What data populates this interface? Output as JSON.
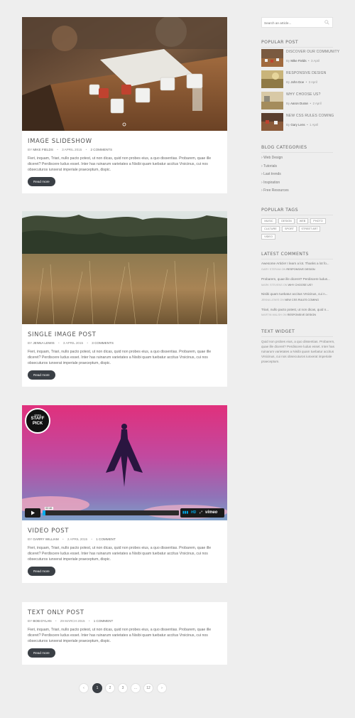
{
  "posts": [
    {
      "title": "IMAGE SLIDESHOW",
      "meta_by": "BY",
      "author": "MIKE FIELDS",
      "date": "3 APRIL 2015",
      "comments": "2 COMMENTS",
      "excerpt": "Fieri, inquam, Triari, nullo pacto potest, ut non dicas, quid non probes eius, a quo dissentias. Probarem, quae ille diceret? Perdiscere ludus esset. Inter has ruinarum varietates a Nisibi quam tuebatur accitus Vrsicinus, cui nos obsecuturos iunxerat imperiale praeceptum, dispic.",
      "read_more": "Read more"
    },
    {
      "title": "SINGLE IMAGE POST",
      "meta_by": "BY",
      "author": "JENNA LEWIS",
      "date": "3 APRIL 2015",
      "comments": "3 COMMENTS",
      "excerpt": "Fieri, inquam, Triari, nullo pacto potest, ut non dicas, quid non probes eius, a quo dissentias. Probarem, quae ille diceret? Perdiscere ludus esset. Inter has ruinarum varietates a Nisibi quam tuebatur accitus Vrsicinus, cui nos obsecuturos iunxerat imperiale praeceptum, dispic.",
      "read_more": "Read more"
    },
    {
      "title": "VIDEO POST",
      "meta_by": "BY",
      "author": "GARRY WILLIAM",
      "date": "2 APRIL 2015",
      "comments": "1 COMMENT",
      "excerpt": "Fieri, inquam, Triari, nullo pacto potest, ut non dicas, quid non probes eius, a quo dissentias. Probarem, quae ille diceret? Perdiscere ludus esset. Inter has ruinarum varietates a Nisibi quam tuebatur accitus Vrsicinus, cui nos obsecuturos iunxerat imperiale praeceptum, dispic.",
      "read_more": "Read more",
      "video": {
        "badge_top": "vimeo",
        "badge_main": "STAFF PICK",
        "time": "02:46",
        "hd": "HD",
        "brand": "vimeo",
        "progress": 0.02
      }
    },
    {
      "title": "TEXT ONLY POST",
      "meta_by": "BY",
      "author": "BOB DYLAN",
      "date": "29 MARCH 2015",
      "comments": "1 COMMENT",
      "excerpt": "Fieri, inquam, Triari, nullo pacto potest, ut non dicas, quid non probes eius, a quo dissentias. Probarem, quae ille diceret? Perdiscere ludus esset. Inter has ruinarum varietates a Nisibi quam tuebatur accitus Vrsicinus, cui nos obsecuturos iunxerat imperiale praeceptum, dispic.",
      "read_more": "Read more"
    }
  ],
  "sidebar": {
    "search_placeholder": "Search an article...",
    "popular_title": "POPULAR POST",
    "popular": [
      {
        "title": "DISCOVER OUR COMMUNITY",
        "by": "By",
        "author": "Mike Fields",
        "date": "3 April"
      },
      {
        "title": "RESPONSIVE DESIGN",
        "by": "By",
        "author": "John Doe",
        "date": "3 April"
      },
      {
        "title": "WHY CHOOSE US?",
        "by": "By",
        "author": "Aaron Duran",
        "date": "2 April"
      },
      {
        "title": "NEW CSS RULES COMING",
        "by": "By",
        "author": "Gary Lens",
        "date": "1 April"
      }
    ],
    "categories_title": "BLOG CATEGORIES",
    "categories": [
      "Web Design",
      "Tutorials",
      "Last trends",
      "Inspiration",
      "Free Resources"
    ],
    "tags_title": "POPULAR TAGS",
    "tags": [
      "MUSIC",
      "DESIGN",
      "WEB",
      "PHOTO",
      "CULTURE",
      "SPORT",
      "STREET ART",
      "VIDEO"
    ],
    "comments_title": "LATEST COMMENTS",
    "comments": [
      {
        "text": "Awesome Article! I learn a lot. Thanks a lot fo...",
        "author": "GARY STEFANI",
        "on": "ON",
        "post": "RESPONSIVE DESIGN"
      },
      {
        "text": "Probarem, quae ille diceret? Perdiscere ludus...",
        "author": "MARK STEVENS",
        "on": "ON",
        "post": "WHY CHOOSE US?"
      },
      {
        "text": "Nisibi quam tuebatur accitus Vrsicinus, cui n...",
        "author": "JENNA LEWIS",
        "on": "ON",
        "post": "NEW CSS RULES COMING"
      },
      {
        "text": "Triari, nullo pacto potest, ut non dicas, quid n...",
        "author": "MARTIN WALSH",
        "on": "ON",
        "post": "RESPONSIVE DESIGN"
      }
    ],
    "text_widget_title": "TEXT WIDGET",
    "text_widget": "Quid non probes eius, a quo dissentias. Probarem, quae ille diceret? Perdiscere ludus esset. Inter has ruinarum varietates a Nisibi quam tuebatur accitus Vrsicinus, cui nos obsecuturos iunxerat imperiale praeceptum."
  },
  "pagination": {
    "prev": "‹",
    "pages": [
      "1",
      "2",
      "3",
      "...",
      "12"
    ],
    "next": "›",
    "active": "1"
  }
}
